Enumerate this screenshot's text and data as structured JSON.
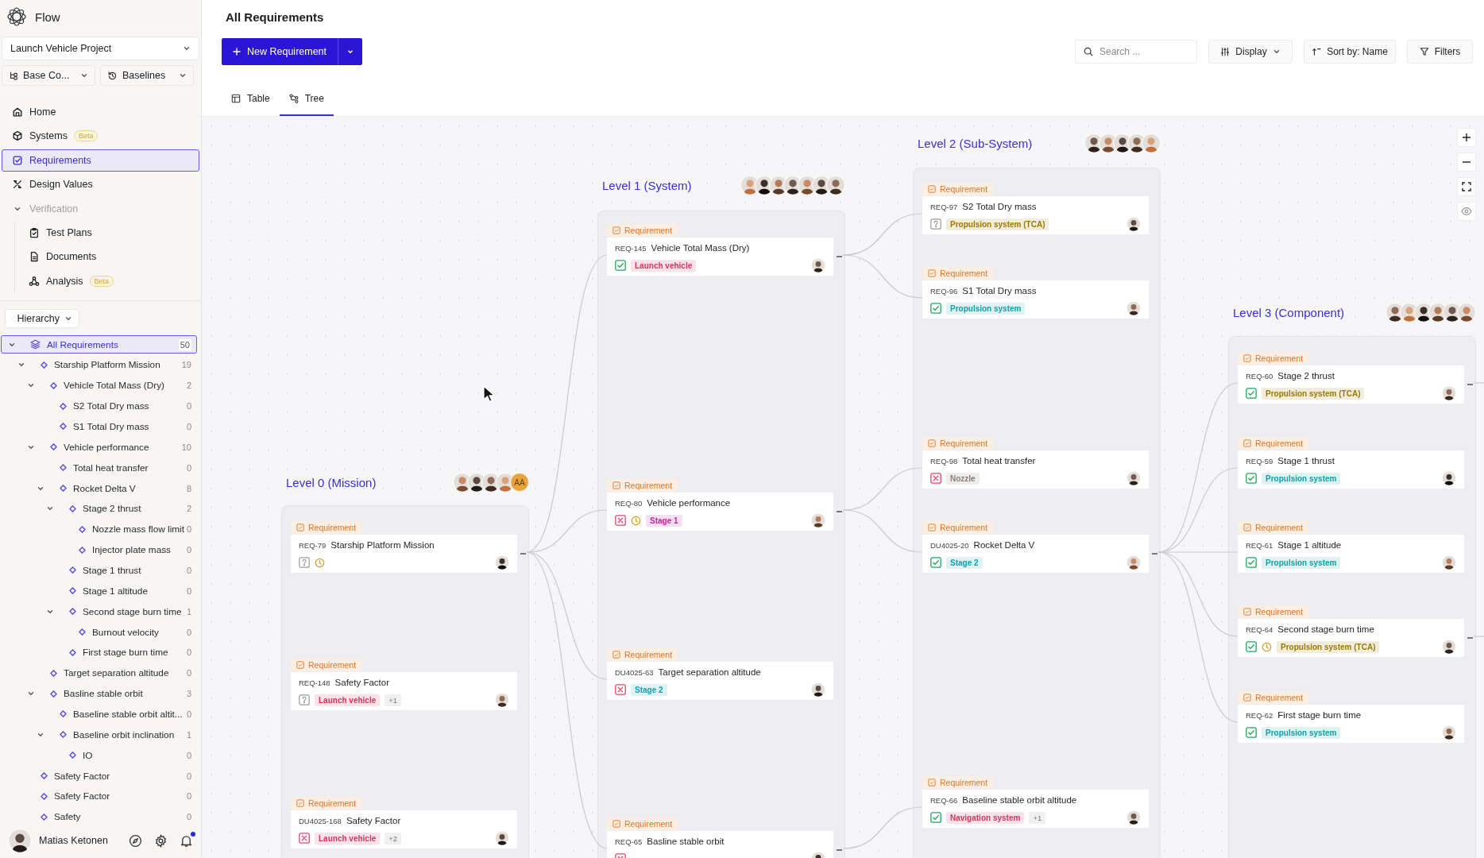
{
  "sidebar": {
    "app_name": "Flow",
    "project": "Launch Vehicle Project",
    "branch": "Base Co...",
    "baselines": "Baselines",
    "nav": [
      {
        "kind": "link",
        "label": "Home",
        "selected": false
      },
      {
        "kind": "link",
        "label": "Systems",
        "badge": "Beta",
        "selected": false
      },
      {
        "kind": "link",
        "label": "Requirements",
        "selected": true
      },
      {
        "kind": "link",
        "label": "Design Values",
        "selected": false
      },
      {
        "kind": "group",
        "label": "Verification",
        "expanded": true,
        "children": [
          {
            "label": "Test Plans",
            "selected": false
          },
          {
            "label": "Documents",
            "selected": false
          },
          {
            "label": "Analysis",
            "badge": "Beta",
            "selected": false
          }
        ]
      }
    ],
    "hierarchy": "Hierarchy",
    "tree": [
      {
        "label": "All Requirements",
        "count": "50",
        "selected": true,
        "expanded": true,
        "children": [
          {
            "label": "Starship Platform Mission",
            "count": "19",
            "selected": false,
            "expanded": true,
            "children": [
              {
                "label": "Vehicle Total Mass (Dry)",
                "count": "2",
                "selected": false,
                "expanded": true,
                "children": [
                  {
                    "label": "S2 Total Dry mass",
                    "count": "0",
                    "selected": false
                  },
                  {
                    "label": "S1 Total Dry mass",
                    "count": "0",
                    "selected": false
                  }
                ]
              },
              {
                "label": "Vehicle performance",
                "count": "10",
                "selected": false,
                "expanded": true,
                "children": [
                  {
                    "label": "Total heat transfer",
                    "count": "0",
                    "selected": false
                  },
                  {
                    "label": "Rocket Delta V",
                    "count": "8",
                    "selected": false,
                    "expanded": true,
                    "children": [
                      {
                        "label": "Stage 2 thrust",
                        "count": "2",
                        "selected": false,
                        "expanded": true,
                        "children": [
                          {
                            "label": "Nozzle mass flow limit",
                            "count": "0",
                            "selected": false
                          },
                          {
                            "label": "Injector plate mass",
                            "count": "0",
                            "selected": false
                          }
                        ]
                      },
                      {
                        "label": "Stage 1 thrust",
                        "count": "0",
                        "selected": false
                      },
                      {
                        "label": "Stage 1 altitude",
                        "count": "0",
                        "selected": false
                      },
                      {
                        "label": "Second stage burn time",
                        "count": "1",
                        "selected": false,
                        "expanded": true,
                        "children": [
                          {
                            "label": "Burnout velocity",
                            "count": "0",
                            "selected": false
                          }
                        ]
                      },
                      {
                        "label": "First stage burn time",
                        "count": "0",
                        "selected": false
                      }
                    ]
                  }
                ]
              },
              {
                "label": "Target separation altitude",
                "count": "0",
                "selected": false
              },
              {
                "label": "Basline stable orbit",
                "count": "3",
                "selected": false,
                "expanded": true,
                "children": [
                  {
                    "label": "Baseline stable orbit altit...",
                    "count": "0",
                    "selected": false
                  },
                  {
                    "label": "Baseline orbit inclination",
                    "count": "1",
                    "selected": false,
                    "expanded": true,
                    "children": [
                      {
                        "label": "IO",
                        "count": "0",
                        "selected": false
                      }
                    ]
                  }
                ]
              }
            ]
          },
          {
            "label": "Safety Factor",
            "count": "0",
            "selected": false
          },
          {
            "label": "Safety Factor",
            "count": "0",
            "selected": false
          },
          {
            "label": "Safety",
            "count": "0",
            "selected": false
          }
        ]
      }
    ],
    "user": {
      "name": "Matias Ketonen",
      "unread": true
    }
  },
  "header": {
    "title": "All Requirements",
    "new_button": "New Requirement",
    "search": {
      "placeholder": "Search ..."
    },
    "display": "Display",
    "sort": "Sort by: Name",
    "filters": "Filters",
    "tabs": [
      {
        "label": "Table",
        "selected": false
      },
      {
        "label": "Tree",
        "selected": true
      }
    ]
  },
  "diagram": {
    "levels": [
      {
        "title": "Level 0 (Mission)",
        "avatars": [
          {
            "kind": "photo"
          },
          {
            "kind": "photo"
          },
          {
            "kind": "photo"
          },
          {
            "kind": "photo"
          },
          {
            "kind": "initials",
            "text": "AA"
          }
        ]
      },
      {
        "title": "Level 1 (System)",
        "avatars": [
          {
            "kind": "photo"
          },
          {
            "kind": "photo"
          },
          {
            "kind": "photo"
          },
          {
            "kind": "photo"
          },
          {
            "kind": "photo"
          },
          {
            "kind": "photo"
          },
          {
            "kind": "photo"
          }
        ]
      },
      {
        "title": "Level 2 (Sub-System)",
        "avatars": [
          {
            "kind": "photo"
          },
          {
            "kind": "photo"
          },
          {
            "kind": "photo"
          },
          {
            "kind": "photo"
          },
          {
            "kind": "photo"
          }
        ]
      },
      {
        "title": "Level 3 (Component)",
        "avatars": [
          {
            "kind": "photo"
          },
          {
            "kind": "photo"
          },
          {
            "kind": "photo"
          },
          {
            "kind": "photo"
          },
          {
            "kind": "photo"
          },
          {
            "kind": "photo"
          }
        ]
      }
    ],
    "cards": [
      {
        "type": "Requirement",
        "id": "REQ-79",
        "title": "Starship Platform Mission",
        "kind": "unknown",
        "warning": true,
        "collapsible": true,
        "children": [
          {
            "type": "Requirement",
            "id": "REQ-145",
            "title": "Vehicle Total Mass (Dry)",
            "kind": "passed",
            "warning": false,
            "tags": [
              {
                "label": "Launch vehicle",
                "color": "#d6345e"
              }
            ],
            "collapsible": true,
            "children": [
              {
                "type": "Requirement",
                "id": "REQ-97",
                "title": "S2 Total Dry mass",
                "kind": "unknown",
                "warning": false,
                "tags": [
                  {
                    "label": "Propulsion system (TCA)",
                    "color": "#9c7a00"
                  }
                ],
                "collapsible": false
              },
              {
                "type": "Requirement",
                "id": "REQ-96",
                "title": "S1 Total Dry mass",
                "kind": "passed",
                "warning": false,
                "tags": [
                  {
                    "label": "Propulsion system",
                    "color": "#13a1a4"
                  }
                ],
                "collapsible": false
              }
            ]
          },
          {
            "type": "Requirement",
            "id": "REQ-80",
            "title": "Vehicle performance",
            "kind": "failed",
            "warning": true,
            "tags": [
              {
                "label": "Stage 1",
                "color": "#c2259e"
              }
            ],
            "collapsible": true,
            "children": [
              {
                "type": "Requirement",
                "id": "REQ-98",
                "title": "Total heat transfer",
                "kind": "failed",
                "warning": false,
                "tags": [
                  {
                    "label": "Nozzle",
                    "color": "#8b7b75"
                  }
                ],
                "collapsible": false
              },
              {
                "type": "Requirement",
                "id": "DU4025-20",
                "title": "Rocket Delta V",
                "kind": "passed",
                "warning": false,
                "tags": [
                  {
                    "label": "Stage 2",
                    "color": "#139fae"
                  }
                ],
                "collapsible": true,
                "children": [
                  {
                    "type": "Requirement",
                    "id": "REQ-60",
                    "title": "Stage 2 thrust",
                    "kind": "passed",
                    "warning": false,
                    "tags": [
                      {
                        "label": "Propulsion system (TCA)",
                        "color": "#9c7a00"
                      }
                    ],
                    "collapsible": true
                  },
                  {
                    "type": "Requirement",
                    "id": "REQ-59",
                    "title": "Stage 1 thrust",
                    "kind": "passed",
                    "warning": false,
                    "tags": [
                      {
                        "label": "Propulsion system",
                        "color": "#13a1a4"
                      }
                    ],
                    "collapsible": false
                  },
                  {
                    "type": "Requirement",
                    "id": "REQ-61",
                    "title": "Stage 1 altitude",
                    "kind": "passed",
                    "warning": false,
                    "tags": [
                      {
                        "label": "Propulsion system",
                        "color": "#13a1a4"
                      }
                    ],
                    "collapsible": false
                  },
                  {
                    "type": "Requirement",
                    "id": "REQ-64",
                    "title": "Second stage burn time",
                    "kind": "passed",
                    "warning": true,
                    "tags": [
                      {
                        "label": "Propulsion system (TCA)",
                        "color": "#9c7a00"
                      }
                    ],
                    "collapsible": true
                  },
                  {
                    "type": "Requirement",
                    "id": "REQ-62",
                    "title": "First stage burn time",
                    "kind": "passed",
                    "warning": false,
                    "tags": [
                      {
                        "label": "Propulsion system",
                        "color": "#13a1a4"
                      }
                    ],
                    "collapsible": false
                  }
                ]
              }
            ]
          },
          {
            "type": "Requirement",
            "id": "DU4025-63",
            "title": "Target separation altitude",
            "kind": "failed",
            "warning": false,
            "tags": [
              {
                "label": "Stage 2",
                "color": "#139fae"
              }
            ],
            "collapsible": false
          },
          {
            "type": "Requirement",
            "id": "REQ-65",
            "title": "Basline stable orbit",
            "kind": "failed",
            "warning": false,
            "collapsible": true,
            "children": [
              {
                "type": "Requirement",
                "id": "REQ-66",
                "title": "Baseline stable orbit altitude",
                "kind": "passed",
                "warning": false,
                "tags": [
                  {
                    "label": "Navigation system",
                    "color": "#d6345e"
                  }
                ],
                "more": "+1",
                "collapsible": false
              }
            ]
          }
        ]
      },
      {
        "type": "Requirement",
        "id": "REQ-148",
        "title": "Safety Factor",
        "kind": "unknown",
        "warning": false,
        "tags": [
          {
            "label": "Launch vehicle",
            "color": "#d6345e"
          }
        ],
        "more": "+1",
        "collapsible": false
      },
      {
        "type": "Requirement",
        "id": "DU4025-168",
        "title": "Safety Factor",
        "kind": "failed",
        "warning": false,
        "tags": [
          {
            "label": "Launch vehicle",
            "color": "#d6345e"
          }
        ],
        "more": "+2",
        "collapsible": false
      }
    ]
  }
}
